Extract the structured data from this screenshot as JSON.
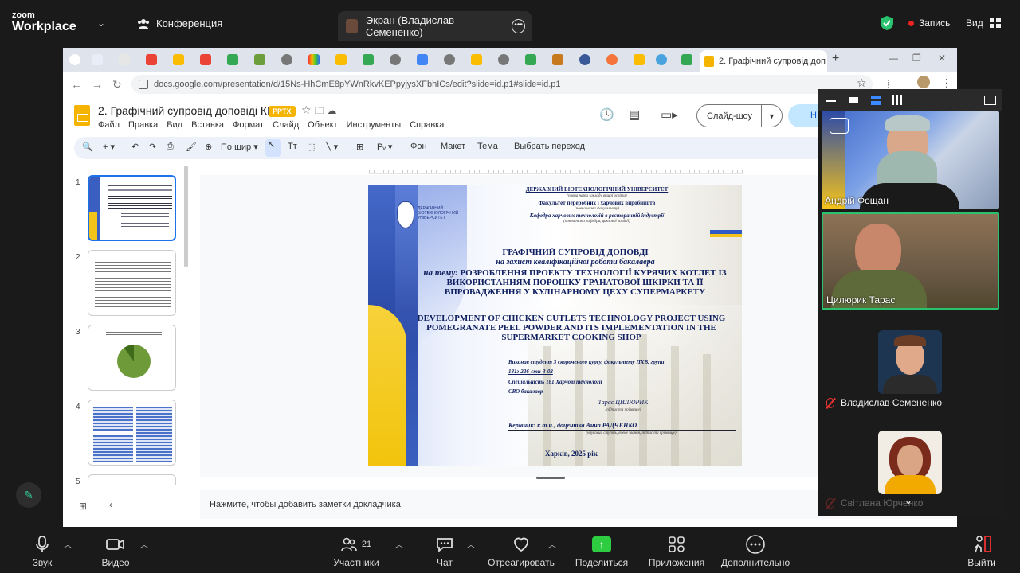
{
  "zoom": {
    "logo_line1": "zoom",
    "logo_line2": "Workplace",
    "conference_label": "Конференция",
    "screen_tab_label": "Экран (Владислав Семененко)",
    "record_label": "Запись",
    "view_label": "Вид",
    "participants_count": "21",
    "bottom": {
      "audio": "Звук",
      "video": "Видео",
      "participants": "Участники",
      "chat": "Чат",
      "react": "Отреагировать",
      "share": "Поделиться",
      "apps": "Приложения",
      "more": "Дополнительно",
      "leave": "Выйти"
    }
  },
  "browser": {
    "active_tab_title": "2. Графічний супровід доп",
    "url": "docs.google.com/presentation/d/15Ns-HhCmE8pYWnRkvKEPpyjysXFbhICs/edit?slide=id.p1#slide=id.p1"
  },
  "docs": {
    "title": "2. Графічний супровід доповіді КР",
    "badge": "PPTX",
    "menu": [
      "Файл",
      "Правка",
      "Вид",
      "Вставка",
      "Формат",
      "Слайд",
      "Объект",
      "Инструменты",
      "Справка"
    ],
    "slideshow_label": "Слайд-шоу",
    "share_label": "Н",
    "toolbar": {
      "zoom": "По шир",
      "background": "Фон",
      "layout": "Макет",
      "theme": "Тема",
      "transition": "Выбрать переход"
    },
    "thumb_numbers": [
      "1",
      "2",
      "3",
      "4",
      "5"
    ],
    "speaker_notes_placeholder": "Нажмите, чтобы добавить заметки докладчика"
  },
  "slide": {
    "university": "ДЕРЖАВНИЙ БІОТЕХНОЛОГІЧНИЙ УНІВЕРСИТЕТ",
    "university_note": "(повна назва закладу вищої освіти)",
    "faculty": "Факультет переробних і харчових виробництв",
    "faculty_note": "(повна назва факультету)",
    "department": "Кафедра харчових технологій в ресторанній індустрії",
    "department_note": "(повна назва кафедри, циклової комісії)",
    "emblem_text": "ДЕРЖАВНИЙ БІОТЕХНОЛОГІЧНИЙ УНІВЕРСИТЕТ",
    "heading": "ГРАФІЧНИЙ СУПРОВІД ДОПОВДІ",
    "subheading": "на захист кваліфікаційної роботи бакалавра",
    "topic_prefix": "на тему:",
    "topic_uk": "РОЗРОБЛЕННЯ ПРОЕКТУ ТЕХНОЛОГІЇ КУРЯЧИХ КОТЛЕТ ІЗ ВИКОРИСТАННЯМ ПОРОШКУ ГРАНАТОВОЇ ШКІРКИ ТА ЇЇ ВПРОВАДЖЕННЯ У КУЛІНАРНОМУ ЦЕХУ СУПЕРМАРКЕТУ",
    "topic_en": "DEVELOPMENT OF CHICKEN CUTLETS TECHNOLOGY PROJECT USING POMEGRANATE PEEL POWDER AND ITS IMPLEMENTATION IN THE SUPERMARKET COOKING SHOP",
    "performer_line1": "Виконав студент 3 скороченого курсу, факультету ПХВ, групи",
    "performer_line2": "181г-226-стн-3-02",
    "specialty": "Спеціальність 181 Харчові технології",
    "degree": "СВО бакалавр",
    "student_name": "Тарас ЦИЛЮРИК",
    "student_note": "(підпис та прізвище)",
    "supervisor": "Керівник: к.т.н., доцентка Анна РАДЧЕНКО",
    "supervisor_note": "(науковий ступінь, вчене звання, підпис та прізвище)",
    "city_year": "Харків, 2025 рік"
  },
  "participants": [
    {
      "name": "Андрій Фощан"
    },
    {
      "name": "Цилюрик Тарас"
    },
    {
      "name": "Владислав Семененко"
    },
    {
      "name": "Світлана Юрченко"
    }
  ],
  "colors": {
    "zoom_bg": "#1a1a1a",
    "active_speaker_border": "#2ac26f",
    "share_green": "#2ecc40",
    "slides_yellow": "#f4b400",
    "google_blue": "#1a73e8"
  }
}
